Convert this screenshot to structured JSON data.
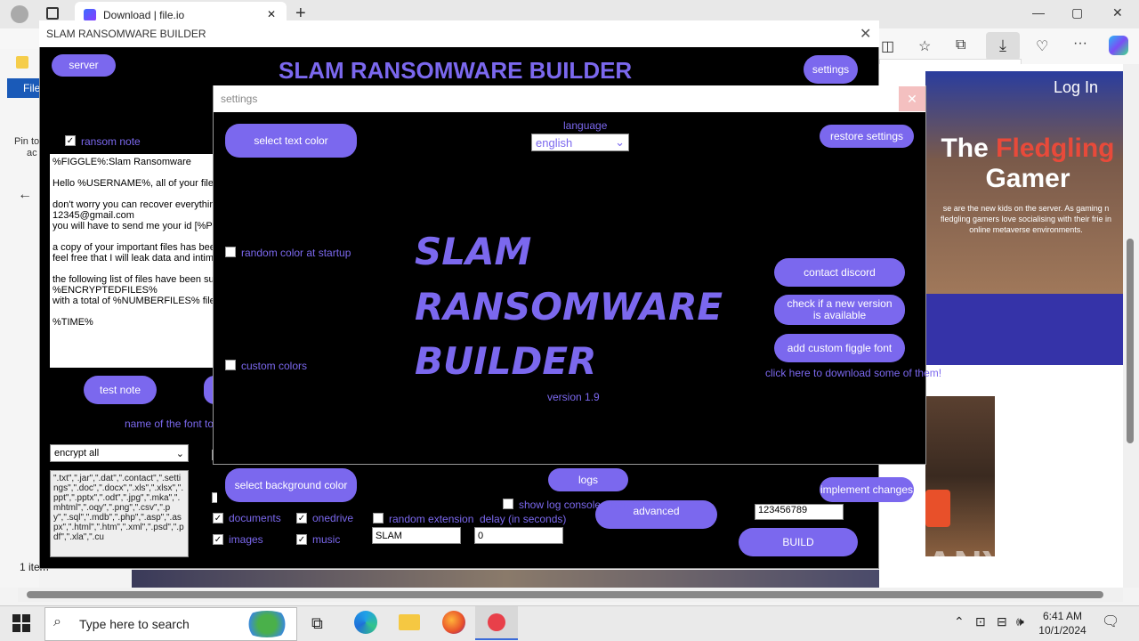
{
  "browser": {
    "tab_title": "Download | file.io",
    "new_tab": "+",
    "minimize": "—",
    "maximize": "▢",
    "close": "✕"
  },
  "website": {
    "login": "Log In",
    "title_1": "The",
    "title_2": "Fledgling",
    "title_3": "Gamer",
    "subtitle": "se are the new kids on the server. As gaming n fledgling gamers love socialising with their frie in online metaverse environments."
  },
  "explorer": {
    "file_tab": "File",
    "pin_text": "Pin to",
    "acc_text": "ac",
    "status": "1 item"
  },
  "builder": {
    "window_title": "SLAM RANSOMWARE BUILDER",
    "heading": "SLAM RANSOMWARE BUILDER",
    "server_button": "server",
    "settings_button": "settings",
    "ransom_note_label": "ransom note",
    "ransom_note_text": "%FIGGLE%:Slam Ransomware\n\nHello %USERNAME%, all of your files \n\ndon't worry you can recover everything\n12345@gmail.com\nyou will have to send me your id [%PEF\n\na copy of your important files has been\nfeel free that I will leak data and intima\n\nthe following list of files have been suc\n%ENCRYPTEDFILES%\nwith a total of %NUMBERFILES% files\n\n%TIME%",
    "test_note_button": "test note",
    "font_label": "name of the font to b",
    "encrypt_select": "encrypt all",
    "extensions_text": "\".txt\",\".jar\",\".dat\",\".contact\",\".settings\",\".doc\",\".docx\",\".xls\",\".xlsx\",\".ppt\",\".pptx\",\".odt\",\".jpg\",\".mka\",\".mhtml\",\".oqy\",\".png\",\".csv\",\".py\",\".sql\",\".mdb\",\".php\",\".asp\",\".aspx\",\".html\",\".htm\",\".xml\",\".psd\",\".pdf\",\".xla\",\".cu",
    "documents_label": "documents",
    "images_label": "images",
    "onedrive_label": "onedrive",
    "music_label": "music",
    "random_extension_label": "random extension",
    "random_extension_value": "SLAM",
    "delay_label": "delay (in seconds)",
    "delay_value": "0",
    "advanced_button": "advanced",
    "id_value": "123456789",
    "build_button": "BUILD"
  },
  "settings": {
    "window_title": "settings",
    "close": "✕",
    "select_text_color": "select text color",
    "language_label": "language",
    "language_value": "english",
    "restore_settings": "restore settings",
    "random_color_label": "random color at startup",
    "custom_colors_label": "custom colors",
    "logo_line_1": "SLAM",
    "logo_line_2": "RANSOMWARE",
    "logo_line_3": "BUILDER",
    "version": "version 1.9",
    "contact_discord": "contact discord",
    "check_version": "check if a new version is available",
    "add_figgle_font": "add custom figgle font",
    "download_fonts_link": "click here to download some of them!",
    "select_background_color": "select background color",
    "logs_button": "logs",
    "show_log_label": "show log console when building",
    "implement_changes": "implement changes"
  },
  "taskbar": {
    "search_placeholder": "Type here to search",
    "time": "6:41 AM",
    "date": "10/1/2024"
  },
  "watermark": "ANY RUN",
  "colors": {
    "accent": "#7b68ee",
    "window_bg": "#000000"
  }
}
